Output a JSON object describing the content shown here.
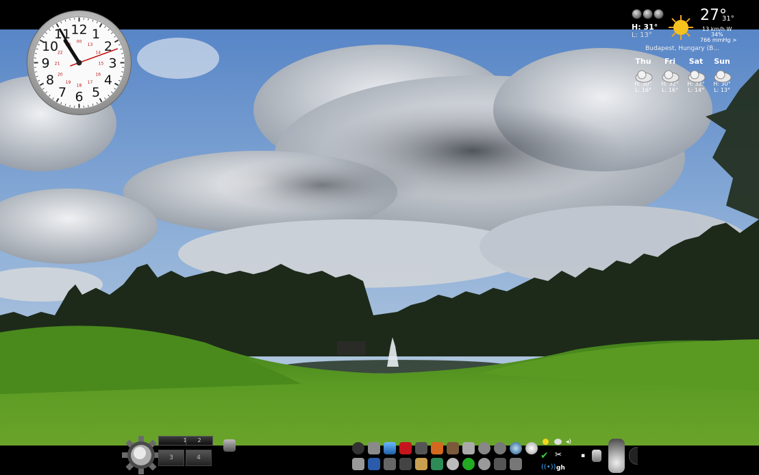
{
  "clock": {
    "numbers": [
      "12",
      "1",
      "2",
      "3",
      "4",
      "5",
      "6",
      "7",
      "8",
      "9",
      "10",
      "11"
    ],
    "inner_numbers": [
      "13",
      "14",
      "15",
      "16",
      "17",
      "18",
      "19",
      "20",
      "21",
      "22",
      "23",
      "00"
    ],
    "time": {
      "hour": 10,
      "minute": 55,
      "second": 7
    }
  },
  "weather": {
    "current_high": "H: 31°",
    "current_low": "L: 13°",
    "temperature": "27°",
    "feels_like": "31°",
    "wind": "13 km/h W",
    "humidity": "34%",
    "pressure": "766 mmHg >",
    "location": "Budapest, Hungary (B...",
    "forecast": [
      {
        "day": "Thu",
        "high": "H: 30°",
        "low": "L: 16°"
      },
      {
        "day": "Fri",
        "high": "H: 32°",
        "low": "L: 16°"
      },
      {
        "day": "Sat",
        "high": "H: 32°",
        "low": "L: 14°"
      },
      {
        "day": "Sun",
        "high": "H: 30°",
        "low": "L: 13°"
      }
    ]
  },
  "dock": {
    "workspaces": [
      "1",
      "2"
    ],
    "workspaces_row2": [
      "3",
      "4"
    ],
    "tray_label": "gh"
  },
  "colors": {
    "sky_top": "#5a86c8",
    "grass": "#4f8f1f",
    "bar": "#000000"
  }
}
